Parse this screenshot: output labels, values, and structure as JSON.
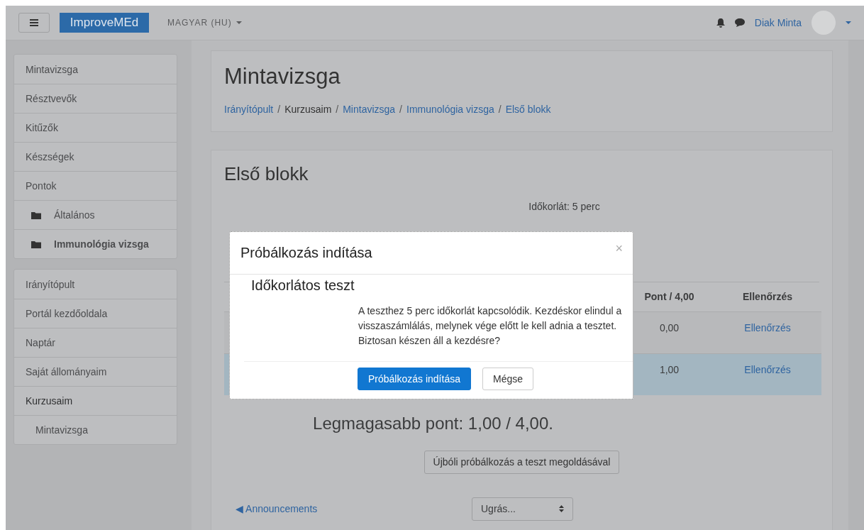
{
  "navbar": {
    "brand": "ImproveMEd",
    "language": "MAGYAR (HU)",
    "user": "Diak Minta"
  },
  "sidebar": {
    "blocks": [
      {
        "items": [
          {
            "label": "Mintavizsga",
            "kind": "link",
            "selected": false
          },
          {
            "label": "Résztvevők",
            "kind": "link",
            "selected": false
          },
          {
            "label": "Kitűzők",
            "kind": "link",
            "selected": false
          },
          {
            "label": "Készségek",
            "kind": "link",
            "selected": false
          },
          {
            "label": "Pontok",
            "kind": "link",
            "selected": false
          },
          {
            "label": "Általános",
            "kind": "folder",
            "selected": false
          },
          {
            "label": "Immunológia vizsga",
            "kind": "folder",
            "selected": true
          }
        ]
      },
      {
        "items": [
          {
            "label": "Irányítópult",
            "kind": "link",
            "selected": false
          },
          {
            "label": "Portál kezdőoldala",
            "kind": "link",
            "selected": false
          },
          {
            "label": "Naptár",
            "kind": "link",
            "selected": false
          },
          {
            "label": "Saját állományaim",
            "kind": "link",
            "selected": false
          },
          {
            "label": "Kurzusaim",
            "kind": "link",
            "selected": false,
            "children": [
              {
                "label": "Mintavizsga",
                "kind": "link",
                "selected": false
              }
            ]
          }
        ]
      }
    ]
  },
  "header": {
    "title": "Mintavizsga",
    "separator": "/",
    "breadcrumb": [
      {
        "label": "Irányítópult",
        "link": true
      },
      {
        "label": "Kurzusaim",
        "link": false
      },
      {
        "label": "Mintavizsga",
        "link": true
      },
      {
        "label": "Immunológia vizsga",
        "link": true
      },
      {
        "label": "Első blokk",
        "link": true
      }
    ]
  },
  "quiz": {
    "title": "Első blokk",
    "info": [
      "Időkorlát: 5 perc"
    ],
    "table": {
      "columns": [
        "Pont / 4,00",
        "Ellenőrzés"
      ],
      "rows": [
        {
          "cells": [
            "0,00",
            "Ellenőrzés"
          ],
          "highlighted": false
        },
        {
          "cells": [
            "1,00",
            "Ellenőrzés"
          ],
          "highlighted": true
        }
      ]
    },
    "best_grade": "Legmagasabb pont: 1,00 / 4,00.",
    "reattempt_button": "Újbóli próbálkozás a teszt megoldásával",
    "prev_link": "◀ Announcements",
    "jump_select": "Ugrás..."
  },
  "modal": {
    "title": "Próbálkozás indítása",
    "close": "×",
    "subtitle": "Időkorlátos teszt",
    "message": "A teszthez 5 perc időkorlát kapcsolódik. Kezdéskor elindul a visszaszámlálás, melynek vége előtt le kell adnia a tesztet. Biztosan készen áll a kezdésre?",
    "buttons": [
      {
        "label": "Próbálkozás indítása",
        "kind": "primary"
      },
      {
        "label": "Mégse",
        "kind": "secondary"
      }
    ]
  }
}
